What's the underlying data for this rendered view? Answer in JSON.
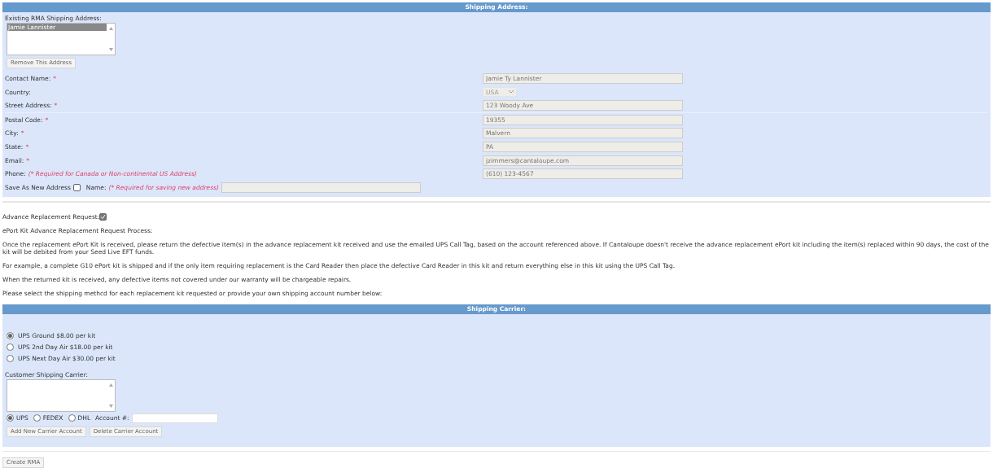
{
  "shipping_address": {
    "title": "Shipping Address:",
    "existing_label": "Existing RMA Shipping Address:",
    "addresses": [
      {
        "name": "Jamie Lannister",
        "selected": true
      }
    ],
    "remove_button": "Remove This Address",
    "fields": [
      {
        "kind": "text",
        "label": "Contact Name:",
        "mark": "*",
        "value": "Jamie Ty Lannister"
      },
      {
        "kind": "select",
        "label": "Country:",
        "value": "USA"
      },
      {
        "kind": "text",
        "label": "Street Address:",
        "mark": "*",
        "value": "123 Woody Ave"
      },
      {
        "kind": "text",
        "label": "Postal Code:",
        "mark": "*",
        "value": "19355"
      },
      {
        "kind": "text",
        "label": "City:",
        "mark": "*",
        "value": "Malvern"
      },
      {
        "kind": "text",
        "label": "State:",
        "mark": "*",
        "value": "PA"
      },
      {
        "kind": "text",
        "label": "Email:",
        "mark": "*",
        "value": "jzimmers@cantaloupe.com"
      },
      {
        "kind": "text",
        "label": "Phone:",
        "note": "(* Required for Canada or Non-continental US Address)",
        "value": "(610) 123-4567"
      }
    ],
    "save_new": {
      "label": "Save As New Address",
      "checked": false,
      "name_label": "Name:",
      "name_note": "(* Required for saving new address)"
    }
  },
  "advance": {
    "label": "Advance Replacement Request:",
    "checked": true
  },
  "paragraphs": [
    "ePort Kit Advance Replacement Request Process:",
    "Once the replacement ePort Kit is received, please return the defective item(s) in the advance replacement kit received and use the emailed UPS Call Tag, based on the account referenced above. If Cantaloupe doesn't receive the advance replacement ePort kit including the item(s) replaced within 90 days, the cost of the kit will be debited from your Seed Live EFT funds.",
    "For example, a complete G10 ePort kit is shipped and if the only item requiring replacement is the Card Reader then place the defective Card Reader in this kit and return everything else in this kit using the UPS Call Tag.",
    "When the returned kit is received, any defective items not covered under our warranty will be chargeable repairs.",
    "Please select the shipping methcd for each replacement kit requested or provide your own shipping account number below:"
  ],
  "shipping_carrier": {
    "title": "Shipping Carrier:",
    "options": [
      {
        "label": "UPS Ground $8.00 per kit",
        "selected": true
      },
      {
        "label": "UPS 2nd Day Air $18.00 per kit",
        "selected": false
      },
      {
        "label": "UPS Next Day Air $30.00 per kit",
        "selected": false
      }
    ],
    "customer_label": "Customer Shipping Carrier:",
    "carriers": [
      {
        "label": "UPS",
        "selected": true
      },
      {
        "label": "FEDEX",
        "selected": false
      },
      {
        "label": "DHL",
        "selected": false
      }
    ],
    "account_label": "Account #:",
    "buttons": [
      "Add New Carrier Account",
      "Delete Carrier Account"
    ]
  },
  "create_button": "Create RMA"
}
